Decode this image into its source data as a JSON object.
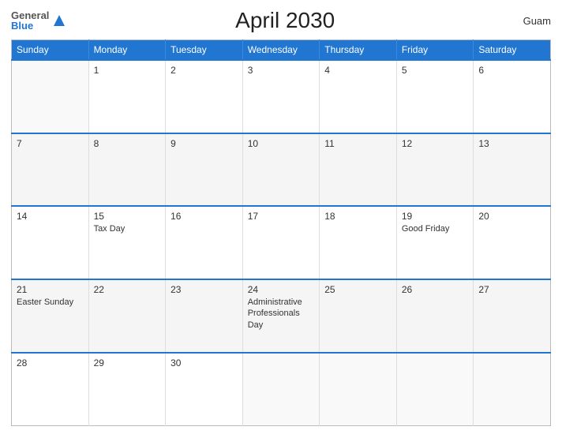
{
  "header": {
    "logo_general": "General",
    "logo_blue": "Blue",
    "title": "April 2030",
    "region": "Guam"
  },
  "calendar": {
    "columns": [
      "Sunday",
      "Monday",
      "Tuesday",
      "Wednesday",
      "Thursday",
      "Friday",
      "Saturday"
    ],
    "weeks": [
      {
        "days": [
          {
            "num": "",
            "events": []
          },
          {
            "num": "1",
            "events": []
          },
          {
            "num": "2",
            "events": []
          },
          {
            "num": "3",
            "events": []
          },
          {
            "num": "4",
            "events": []
          },
          {
            "num": "5",
            "events": []
          },
          {
            "num": "6",
            "events": []
          }
        ]
      },
      {
        "days": [
          {
            "num": "7",
            "events": []
          },
          {
            "num": "8",
            "events": []
          },
          {
            "num": "9",
            "events": []
          },
          {
            "num": "10",
            "events": []
          },
          {
            "num": "11",
            "events": []
          },
          {
            "num": "12",
            "events": []
          },
          {
            "num": "13",
            "events": []
          }
        ]
      },
      {
        "days": [
          {
            "num": "14",
            "events": []
          },
          {
            "num": "15",
            "events": [
              "Tax Day"
            ]
          },
          {
            "num": "16",
            "events": []
          },
          {
            "num": "17",
            "events": []
          },
          {
            "num": "18",
            "events": []
          },
          {
            "num": "19",
            "events": [
              "Good Friday"
            ]
          },
          {
            "num": "20",
            "events": []
          }
        ]
      },
      {
        "days": [
          {
            "num": "21",
            "events": [
              "Easter Sunday"
            ]
          },
          {
            "num": "22",
            "events": []
          },
          {
            "num": "23",
            "events": []
          },
          {
            "num": "24",
            "events": [
              "Administrative Professionals Day"
            ]
          },
          {
            "num": "25",
            "events": []
          },
          {
            "num": "26",
            "events": []
          },
          {
            "num": "27",
            "events": []
          }
        ]
      },
      {
        "days": [
          {
            "num": "28",
            "events": []
          },
          {
            "num": "29",
            "events": []
          },
          {
            "num": "30",
            "events": []
          },
          {
            "num": "",
            "events": []
          },
          {
            "num": "",
            "events": []
          },
          {
            "num": "",
            "events": []
          },
          {
            "num": "",
            "events": []
          }
        ]
      }
    ]
  }
}
